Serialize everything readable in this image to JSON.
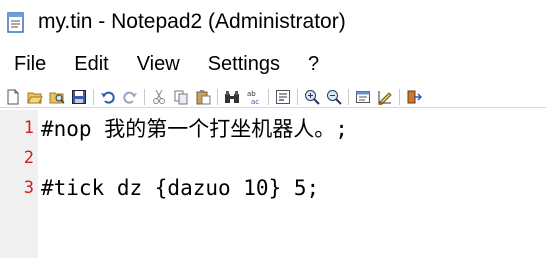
{
  "window": {
    "title": "my.tin - Notepad2 (Administrator)"
  },
  "menu": {
    "items": [
      "File",
      "Edit",
      "View",
      "Settings",
      "?"
    ]
  },
  "toolbar": {
    "buttons": [
      "new-icon",
      "open-icon",
      "browse-icon",
      "save-icon",
      "undo-icon",
      "redo-icon",
      "cut-icon",
      "copy-icon",
      "paste-icon",
      "find-icon",
      "replace-icon",
      "word-wrap-icon",
      "zoom-in-icon",
      "zoom-out-icon",
      "scheme-icon",
      "customize-icon",
      "exit-icon"
    ]
  },
  "editor": {
    "lines": [
      {
        "number": "1",
        "text": "#nop 我的第一个打坐机器人。;"
      },
      {
        "number": "2",
        "text": ""
      },
      {
        "number": "3",
        "text": "#tick dz {dazuo 10} 5;"
      }
    ]
  },
  "colors": {
    "line_number": "#d21f1f",
    "gutter": "#f0f0f0"
  }
}
